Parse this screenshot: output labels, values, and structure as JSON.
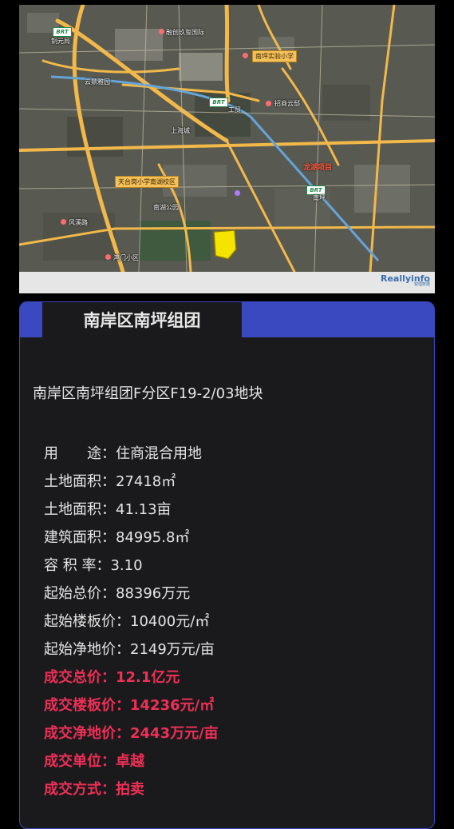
{
  "map": {
    "labels": {
      "tongyuanju": "铜元局",
      "rongchuang": "融创玖玺国际",
      "nanping_school": "南坪实验小学",
      "zhaoshang": "招商云邸",
      "tianning": "天台岗小学南湖校区",
      "longhu": "龙湖项目",
      "gongmao": "工贸",
      "nanping": "南坪",
      "shanghai_city": "上海城",
      "yunheng": "云鼎雅园",
      "fengxi": "风溪路",
      "nanhu_park": "南湖公园",
      "hongmen": "鸿门小区"
    },
    "brt_label": "BRT",
    "watermark": {
      "brand": "Reallyinfo",
      "sub": "锐理数据"
    }
  },
  "card": {
    "tab_title": "南岸区南坪组团",
    "parcel_title": "南岸区南坪组团F分区F19-2/03地块",
    "rows": [
      {
        "text": "用　　途：住商混合用地",
        "highlight": false
      },
      {
        "text": "土地面积：27418㎡",
        "highlight": false
      },
      {
        "text": "土地面积：41.13亩",
        "highlight": false
      },
      {
        "text": "建筑面积：84995.8㎡",
        "highlight": false
      },
      {
        "text": "容 积 率：3.10",
        "highlight": false
      },
      {
        "text": "起始总价：88396万元",
        "highlight": false
      },
      {
        "text": "起始楼板价：10400元/㎡",
        "highlight": false
      },
      {
        "text": "起始净地价：2149万元/亩",
        "highlight": false
      },
      {
        "text": "成交总价：12.1亿元",
        "highlight": true
      },
      {
        "text": "成交楼板价：14236元/㎡",
        "highlight": true
      },
      {
        "text": "成交净地价：2443万元/亩",
        "highlight": true
      },
      {
        "text": "成交单位：卓越",
        "highlight": true
      },
      {
        "text": "成交方式：拍卖",
        "highlight": true
      }
    ]
  },
  "colors": {
    "accent_blue": "#3a49c0",
    "highlight_red": "#ee2f56",
    "parcel_yellow": "#f5e400"
  }
}
